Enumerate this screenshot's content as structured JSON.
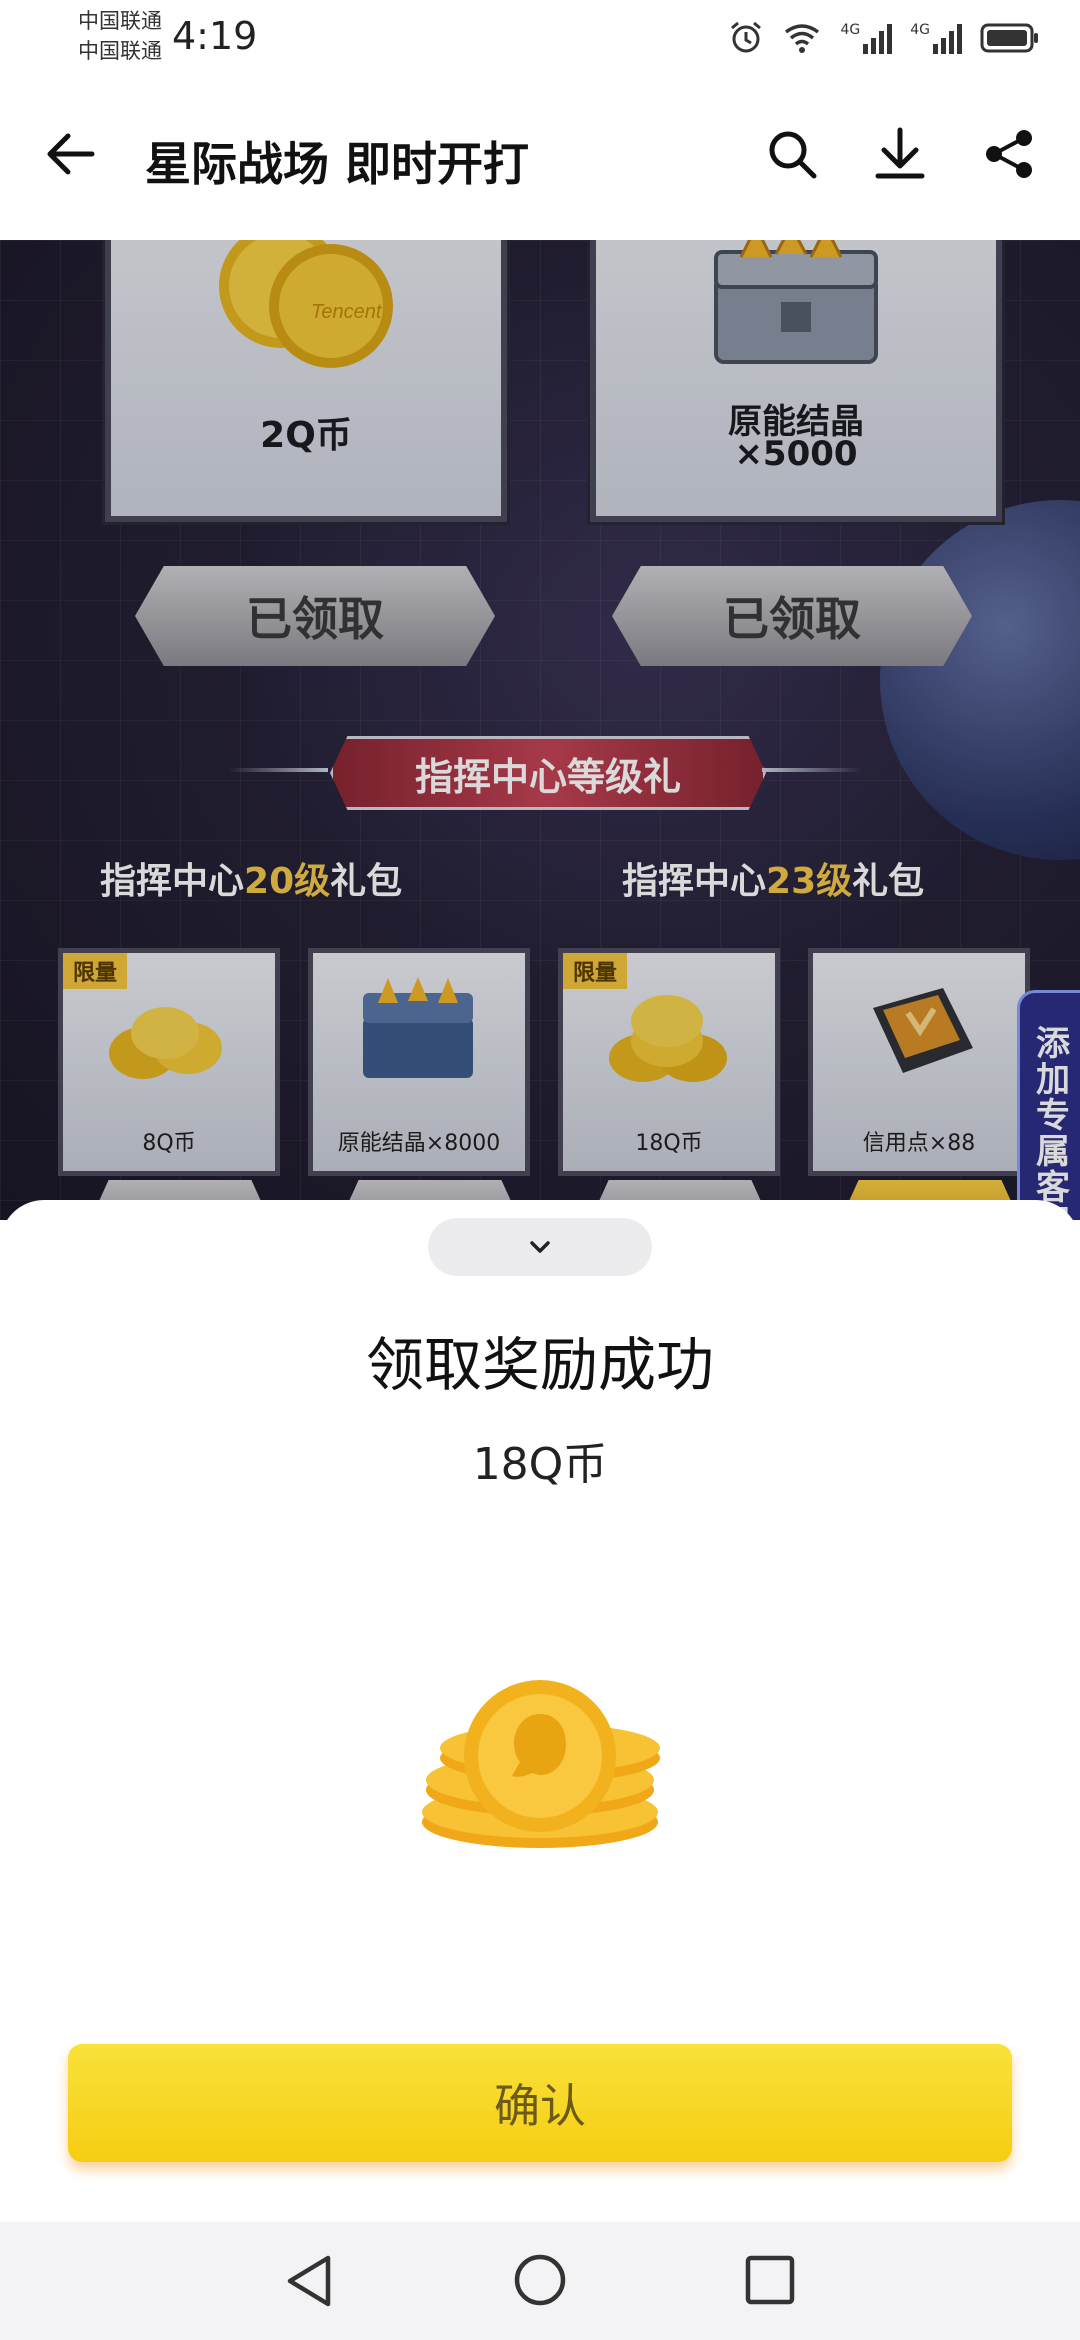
{
  "status_bar": {
    "carrier_1": "中国联通",
    "carrier_2": "中国联通",
    "time": "4:19",
    "network_1": "4G",
    "network_2": "4G"
  },
  "app_bar": {
    "title": "星际战场 即时开打",
    "icons": [
      "back-icon",
      "search-icon",
      "download-icon",
      "share-icon"
    ]
  },
  "game": {
    "top_rewards": [
      {
        "label": "2Q币",
        "button": "已领取"
      },
      {
        "label_line1": "原能结晶",
        "label_line2": "×5000",
        "button": "已领取"
      }
    ],
    "section_title": "指挥中心等级礼",
    "pack_20": {
      "prefix": "指挥中心",
      "level": "20级",
      "suffix": "礼包"
    },
    "pack_23": {
      "prefix": "指挥中心",
      "level": "23级",
      "suffix": "礼包"
    },
    "items": [
      {
        "tag": "限量",
        "label": "8Q币"
      },
      {
        "label": "原能结晶×8000"
      },
      {
        "tag": "限量",
        "label": "18Q币"
      },
      {
        "label": "信用点×88"
      }
    ],
    "customer_service": "添加专属客服"
  },
  "sheet": {
    "title": "领取奖励成功",
    "reward": "18Q币",
    "confirm_label": "确认"
  },
  "colors": {
    "accent_yellow": "#f6cd12",
    "game_bg": "#262238",
    "banner_red": "#c44456",
    "cs_tab_blue": "#2e2f88"
  }
}
